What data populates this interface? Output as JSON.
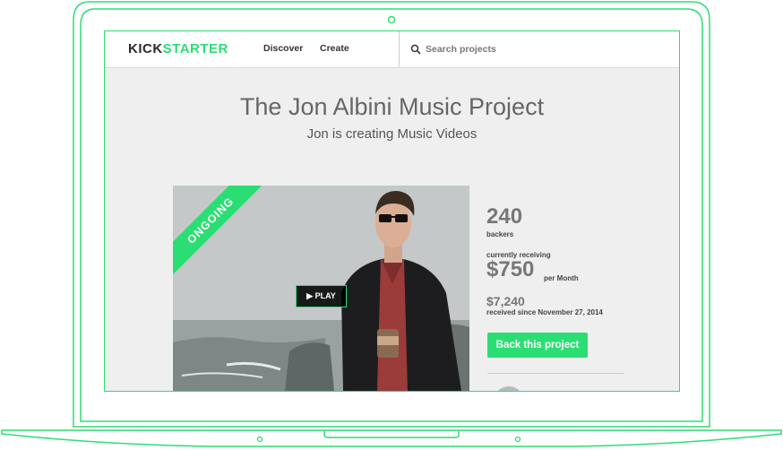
{
  "colors": {
    "accent": "#2bde73",
    "title_gray": "#666666",
    "background": "#efefef"
  },
  "header": {
    "logo_part1": "KICK",
    "logo_part2": "STARTER",
    "nav": [
      {
        "label": "Discover"
      },
      {
        "label": "Create"
      }
    ],
    "search": {
      "placeholder": "Search projects",
      "value": ""
    },
    "search_icon": "search-icon"
  },
  "project": {
    "title": "The Jon Albini Music Project",
    "subtitle": "Jon is creating Music Videos",
    "status_ribbon": "ONGOING",
    "play_label": "PLAY",
    "play_icon": "play-icon"
  },
  "stats": {
    "backers_count": "240",
    "backers_label": "backers",
    "currently_label": "currently receiving",
    "amount": "$750",
    "per_label": "per Month",
    "total": "$7,240",
    "since": "received since November 27, 2014"
  },
  "cta": {
    "back_label": "Back this project"
  }
}
